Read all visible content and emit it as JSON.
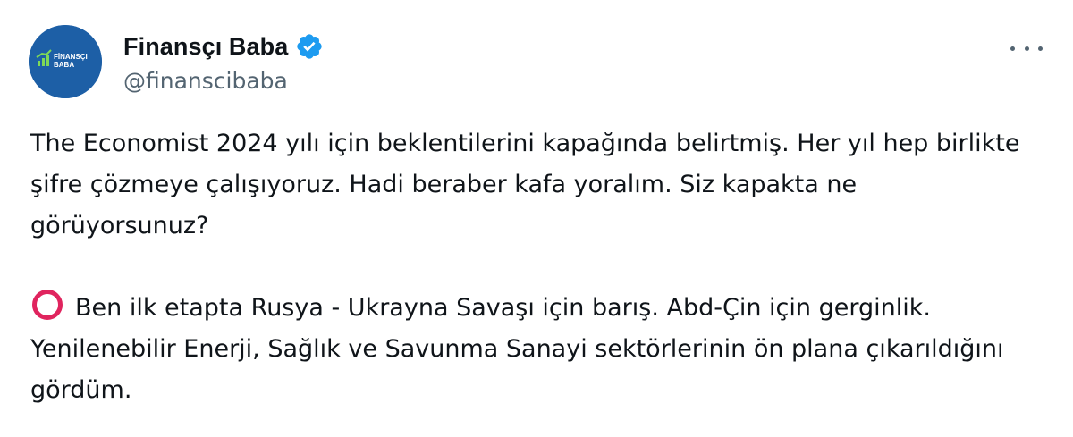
{
  "author": {
    "display_name": "Finansçı Baba",
    "handle": "@finanscibaba",
    "avatar_text_line1": "FİNANSÇI",
    "avatar_text_line2": "BABA",
    "verified_icon": "verified-badge-icon"
  },
  "tweet": {
    "paragraph1": "The Economist 2024 yılı için beklentilerini kapağında belirtmiş. Her yıl hep birlikte şifre çözmeye çalışıyoruz. Hadi beraber kafa yoralım. Siz kapakta ne görüyorsunuz?",
    "paragraph2_text": "Ben ilk etapta Rusya - Ukrayna Savaşı için barış. Abd-Çin için gerginlik. Yenilenebilir Enerji, Sağlık ve Savunma Sanayi sektörlerinin ön plana çıkarıldığını gördüm.",
    "paragraph2_icon": "red-circle-icon"
  },
  "colors": {
    "verified": "#1d9bf0",
    "avatar_bg": "#1d5fa6",
    "secondary_text": "#536471",
    "circle_red": "#e0245e"
  }
}
